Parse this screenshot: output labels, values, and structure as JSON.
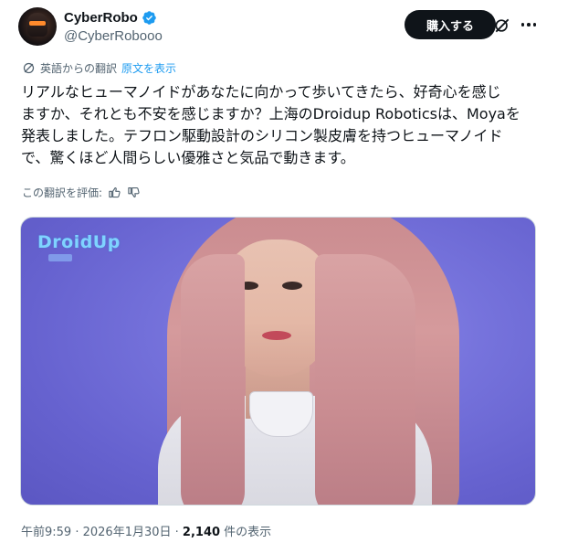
{
  "author": {
    "display_name": "CyberRobo",
    "handle": "@CyberRobooo",
    "avatar_icon": "robot-avatar",
    "verified_icon": "verified-badge-icon",
    "verified_color": "#1d9bf0"
  },
  "actions": {
    "buy_label": "購入する",
    "grok_icon": "grok-icon",
    "more_icon": "more-icon"
  },
  "translation": {
    "translated_from": "英語からの翻訳",
    "show_original": "原文を表示",
    "link_color": "#1d9bf0"
  },
  "tweet": {
    "lines": [
      "リアルなヒューマノイドがあなたに向かって歩いてきたら、好奇心を感じ",
      "ますか、それとも不安を感じますか？上海のDroidup Roboticsは、Moyaを",
      "発表しました。テフロン駆動設計のシリコン製皮膚を持つヒューマノイド",
      "で、驚くほど人間らしい優雅さと気品で動きます。"
    ]
  },
  "rating": {
    "label": "この翻訳を評価:",
    "thumbs_up_icon": "thumbs-up-icon",
    "thumbs_down_icon": "thumbs-down-icon"
  },
  "media": {
    "watermark": "DroidUp"
  },
  "meta": {
    "time": "午前9:59",
    "separator": " · ",
    "date": "2026年1月30日",
    "views_count": "2,140",
    "views_label": " 件の表示"
  }
}
